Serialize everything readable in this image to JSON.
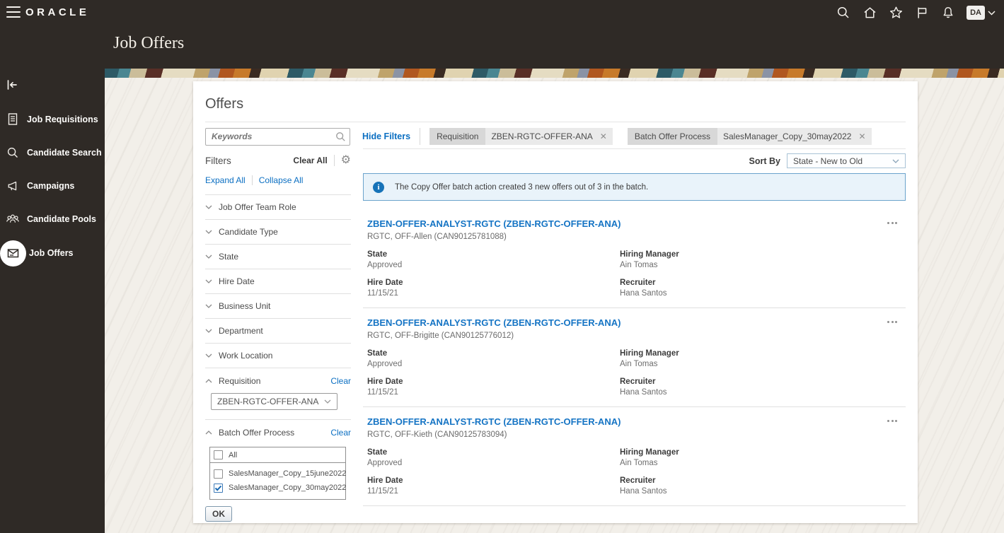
{
  "header": {
    "brand": "ORACLE",
    "page_title": "Job Offers",
    "avatar_initials": "DA"
  },
  "sidebar": {
    "items": [
      {
        "label": "Job Requisitions",
        "icon": "document-icon",
        "active": false
      },
      {
        "label": "Candidate Search",
        "icon": "search-icon",
        "active": false
      },
      {
        "label": "Campaigns",
        "icon": "megaphone-icon",
        "active": false
      },
      {
        "label": "Candidate Pools",
        "icon": "people-icon",
        "active": false
      },
      {
        "label": "Job Offers",
        "icon": "offer-letter-icon",
        "active": true
      }
    ]
  },
  "offers_panel": {
    "title": "Offers",
    "keywords_placeholder": "Keywords",
    "hide_filters_label": "Hide Filters",
    "chips": [
      {
        "label": "Requisition",
        "value": "ZBEN-RGTC-OFFER-ANA"
      },
      {
        "label": "Batch Offer Process",
        "value": "SalesManager_Copy_30may2022"
      }
    ],
    "sort": {
      "label": "Sort By",
      "value": "State - New to Old"
    },
    "info_banner": "The Copy Offer batch action created 3 new offers out of 3 in the batch.",
    "filters": {
      "title": "Filters",
      "clear_all_label": "Clear All",
      "expand_all_label": "Expand All",
      "collapse_all_label": "Collapse All",
      "collapsed_groups": [
        {
          "label": "Job Offer Team Role"
        },
        {
          "label": "Candidate Type"
        },
        {
          "label": "State"
        },
        {
          "label": "Hire Date"
        },
        {
          "label": "Business Unit"
        },
        {
          "label": "Department"
        },
        {
          "label": "Work Location"
        }
      ],
      "requisition": {
        "label": "Requisition",
        "clear_label": "Clear",
        "selected": "ZBEN-RGTC-OFFER-ANA"
      },
      "batch_offer_process": {
        "label": "Batch Offer Process",
        "clear_label": "Clear",
        "all_option": {
          "label": "All",
          "checked": false
        },
        "options": [
          {
            "label": "SalesManager_Copy_15june2022",
            "checked": false
          },
          {
            "label": "SalesManager_Copy_30may2022",
            "checked": true
          }
        ],
        "ok_label": "OK"
      }
    },
    "offers": [
      {
        "title": "ZBEN-OFFER-ANALYST-RGTC (ZBEN-RGTC-OFFER-ANA)",
        "subtitle": "RGTC, OFF-Allen (CAN90125781088)",
        "state_label": "State",
        "state": "Approved",
        "hiring_manager_label": "Hiring Manager",
        "hiring_manager": "Ain Tomas",
        "hire_date_label": "Hire Date",
        "hire_date": "11/15/21",
        "recruiter_label": "Recruiter",
        "recruiter": "Hana Santos"
      },
      {
        "title": "ZBEN-OFFER-ANALYST-RGTC (ZBEN-RGTC-OFFER-ANA)",
        "subtitle": "RGTC, OFF-Brigitte (CAN90125776012)",
        "state_label": "State",
        "state": "Approved",
        "hiring_manager_label": "Hiring Manager",
        "hiring_manager": "Ain Tomas",
        "hire_date_label": "Hire Date",
        "hire_date": "11/15/21",
        "recruiter_label": "Recruiter",
        "recruiter": "Hana Santos"
      },
      {
        "title": "ZBEN-OFFER-ANALYST-RGTC (ZBEN-RGTC-OFFER-ANA)",
        "subtitle": "RGTC, OFF-Kieth (CAN90125783094)",
        "state_label": "State",
        "state": "Approved",
        "hiring_manager_label": "Hiring Manager",
        "hiring_manager": "Ain Tomas",
        "hire_date_label": "Hire Date",
        "hire_date": "11/15/21",
        "recruiter_label": "Recruiter",
        "recruiter": "Hana Santos"
      }
    ]
  },
  "colors": {
    "chrome_dark": "#2f2a26",
    "accent_blue": "#0b6fc2",
    "banner_bg": "#e9f3fa",
    "banner_border": "#6ba3cc",
    "page_bg": "#f2efe9"
  }
}
